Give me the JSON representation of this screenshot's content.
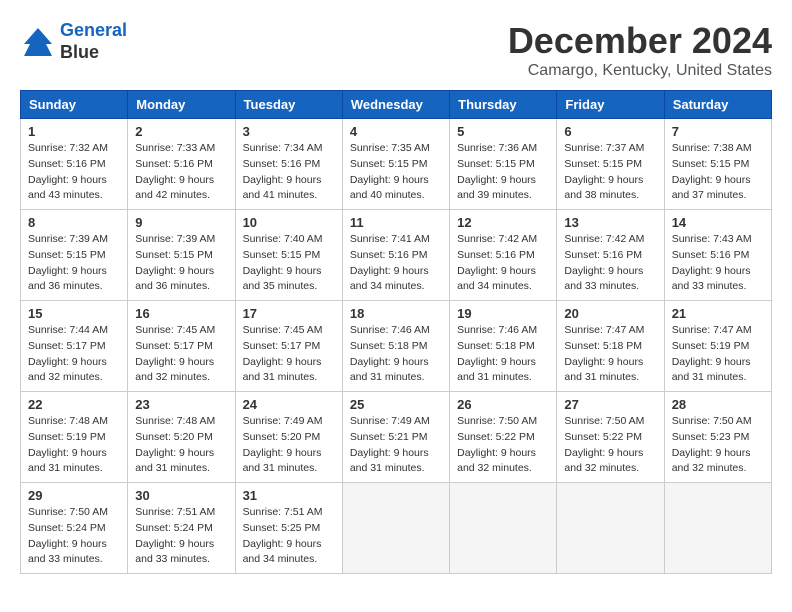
{
  "header": {
    "logo_line1": "General",
    "logo_line2": "Blue",
    "month": "December 2024",
    "location": "Camargo, Kentucky, United States"
  },
  "weekdays": [
    "Sunday",
    "Monday",
    "Tuesday",
    "Wednesday",
    "Thursday",
    "Friday",
    "Saturday"
  ],
  "weeks": [
    [
      {
        "day": "1",
        "rise": "7:32 AM",
        "set": "5:16 PM",
        "daylight": "9 hours and 43 minutes."
      },
      {
        "day": "2",
        "rise": "7:33 AM",
        "set": "5:16 PM",
        "daylight": "9 hours and 42 minutes."
      },
      {
        "day": "3",
        "rise": "7:34 AM",
        "set": "5:16 PM",
        "daylight": "9 hours and 41 minutes."
      },
      {
        "day": "4",
        "rise": "7:35 AM",
        "set": "5:15 PM",
        "daylight": "9 hours and 40 minutes."
      },
      {
        "day": "5",
        "rise": "7:36 AM",
        "set": "5:15 PM",
        "daylight": "9 hours and 39 minutes."
      },
      {
        "day": "6",
        "rise": "7:37 AM",
        "set": "5:15 PM",
        "daylight": "9 hours and 38 minutes."
      },
      {
        "day": "7",
        "rise": "7:38 AM",
        "set": "5:15 PM",
        "daylight": "9 hours and 37 minutes."
      }
    ],
    [
      {
        "day": "8",
        "rise": "7:39 AM",
        "set": "5:15 PM",
        "daylight": "9 hours and 36 minutes."
      },
      {
        "day": "9",
        "rise": "7:39 AM",
        "set": "5:15 PM",
        "daylight": "9 hours and 36 minutes."
      },
      {
        "day": "10",
        "rise": "7:40 AM",
        "set": "5:15 PM",
        "daylight": "9 hours and 35 minutes."
      },
      {
        "day": "11",
        "rise": "7:41 AM",
        "set": "5:16 PM",
        "daylight": "9 hours and 34 minutes."
      },
      {
        "day": "12",
        "rise": "7:42 AM",
        "set": "5:16 PM",
        "daylight": "9 hours and 34 minutes."
      },
      {
        "day": "13",
        "rise": "7:42 AM",
        "set": "5:16 PM",
        "daylight": "9 hours and 33 minutes."
      },
      {
        "day": "14",
        "rise": "7:43 AM",
        "set": "5:16 PM",
        "daylight": "9 hours and 33 minutes."
      }
    ],
    [
      {
        "day": "15",
        "rise": "7:44 AM",
        "set": "5:17 PM",
        "daylight": "9 hours and 32 minutes."
      },
      {
        "day": "16",
        "rise": "7:45 AM",
        "set": "5:17 PM",
        "daylight": "9 hours and 32 minutes."
      },
      {
        "day": "17",
        "rise": "7:45 AM",
        "set": "5:17 PM",
        "daylight": "9 hours and 31 minutes."
      },
      {
        "day": "18",
        "rise": "7:46 AM",
        "set": "5:18 PM",
        "daylight": "9 hours and 31 minutes."
      },
      {
        "day": "19",
        "rise": "7:46 AM",
        "set": "5:18 PM",
        "daylight": "9 hours and 31 minutes."
      },
      {
        "day": "20",
        "rise": "7:47 AM",
        "set": "5:18 PM",
        "daylight": "9 hours and 31 minutes."
      },
      {
        "day": "21",
        "rise": "7:47 AM",
        "set": "5:19 PM",
        "daylight": "9 hours and 31 minutes."
      }
    ],
    [
      {
        "day": "22",
        "rise": "7:48 AM",
        "set": "5:19 PM",
        "daylight": "9 hours and 31 minutes."
      },
      {
        "day": "23",
        "rise": "7:48 AM",
        "set": "5:20 PM",
        "daylight": "9 hours and 31 minutes."
      },
      {
        "day": "24",
        "rise": "7:49 AM",
        "set": "5:20 PM",
        "daylight": "9 hours and 31 minutes."
      },
      {
        "day": "25",
        "rise": "7:49 AM",
        "set": "5:21 PM",
        "daylight": "9 hours and 31 minutes."
      },
      {
        "day": "26",
        "rise": "7:50 AM",
        "set": "5:22 PM",
        "daylight": "9 hours and 32 minutes."
      },
      {
        "day": "27",
        "rise": "7:50 AM",
        "set": "5:22 PM",
        "daylight": "9 hours and 32 minutes."
      },
      {
        "day": "28",
        "rise": "7:50 AM",
        "set": "5:23 PM",
        "daylight": "9 hours and 32 minutes."
      }
    ],
    [
      {
        "day": "29",
        "rise": "7:50 AM",
        "set": "5:24 PM",
        "daylight": "9 hours and 33 minutes."
      },
      {
        "day": "30",
        "rise": "7:51 AM",
        "set": "5:24 PM",
        "daylight": "9 hours and 33 minutes."
      },
      {
        "day": "31",
        "rise": "7:51 AM",
        "set": "5:25 PM",
        "daylight": "9 hours and 34 minutes."
      },
      null,
      null,
      null,
      null
    ]
  ]
}
